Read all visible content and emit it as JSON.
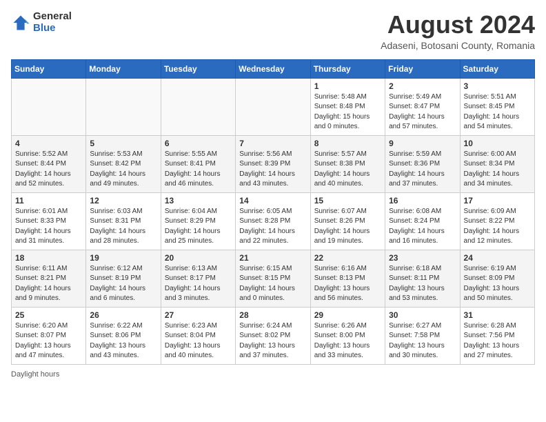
{
  "header": {
    "logo_general": "General",
    "logo_blue": "Blue",
    "title": "August 2024",
    "subtitle": "Adaseni, Botosani County, Romania"
  },
  "days_of_week": [
    "Sunday",
    "Monday",
    "Tuesday",
    "Wednesday",
    "Thursday",
    "Friday",
    "Saturday"
  ],
  "weeks": [
    [
      {
        "day": "",
        "info": ""
      },
      {
        "day": "",
        "info": ""
      },
      {
        "day": "",
        "info": ""
      },
      {
        "day": "",
        "info": ""
      },
      {
        "day": "1",
        "info": "Sunrise: 5:48 AM\nSunset: 8:48 PM\nDaylight: 15 hours\nand 0 minutes."
      },
      {
        "day": "2",
        "info": "Sunrise: 5:49 AM\nSunset: 8:47 PM\nDaylight: 14 hours\nand 57 minutes."
      },
      {
        "day": "3",
        "info": "Sunrise: 5:51 AM\nSunset: 8:45 PM\nDaylight: 14 hours\nand 54 minutes."
      }
    ],
    [
      {
        "day": "4",
        "info": "Sunrise: 5:52 AM\nSunset: 8:44 PM\nDaylight: 14 hours\nand 52 minutes."
      },
      {
        "day": "5",
        "info": "Sunrise: 5:53 AM\nSunset: 8:42 PM\nDaylight: 14 hours\nand 49 minutes."
      },
      {
        "day": "6",
        "info": "Sunrise: 5:55 AM\nSunset: 8:41 PM\nDaylight: 14 hours\nand 46 minutes."
      },
      {
        "day": "7",
        "info": "Sunrise: 5:56 AM\nSunset: 8:39 PM\nDaylight: 14 hours\nand 43 minutes."
      },
      {
        "day": "8",
        "info": "Sunrise: 5:57 AM\nSunset: 8:38 PM\nDaylight: 14 hours\nand 40 minutes."
      },
      {
        "day": "9",
        "info": "Sunrise: 5:59 AM\nSunset: 8:36 PM\nDaylight: 14 hours\nand 37 minutes."
      },
      {
        "day": "10",
        "info": "Sunrise: 6:00 AM\nSunset: 8:34 PM\nDaylight: 14 hours\nand 34 minutes."
      }
    ],
    [
      {
        "day": "11",
        "info": "Sunrise: 6:01 AM\nSunset: 8:33 PM\nDaylight: 14 hours\nand 31 minutes."
      },
      {
        "day": "12",
        "info": "Sunrise: 6:03 AM\nSunset: 8:31 PM\nDaylight: 14 hours\nand 28 minutes."
      },
      {
        "day": "13",
        "info": "Sunrise: 6:04 AM\nSunset: 8:29 PM\nDaylight: 14 hours\nand 25 minutes."
      },
      {
        "day": "14",
        "info": "Sunrise: 6:05 AM\nSunset: 8:28 PM\nDaylight: 14 hours\nand 22 minutes."
      },
      {
        "day": "15",
        "info": "Sunrise: 6:07 AM\nSunset: 8:26 PM\nDaylight: 14 hours\nand 19 minutes."
      },
      {
        "day": "16",
        "info": "Sunrise: 6:08 AM\nSunset: 8:24 PM\nDaylight: 14 hours\nand 16 minutes."
      },
      {
        "day": "17",
        "info": "Sunrise: 6:09 AM\nSunset: 8:22 PM\nDaylight: 14 hours\nand 12 minutes."
      }
    ],
    [
      {
        "day": "18",
        "info": "Sunrise: 6:11 AM\nSunset: 8:21 PM\nDaylight: 14 hours\nand 9 minutes."
      },
      {
        "day": "19",
        "info": "Sunrise: 6:12 AM\nSunset: 8:19 PM\nDaylight: 14 hours\nand 6 minutes."
      },
      {
        "day": "20",
        "info": "Sunrise: 6:13 AM\nSunset: 8:17 PM\nDaylight: 14 hours\nand 3 minutes."
      },
      {
        "day": "21",
        "info": "Sunrise: 6:15 AM\nSunset: 8:15 PM\nDaylight: 14 hours\nand 0 minutes."
      },
      {
        "day": "22",
        "info": "Sunrise: 6:16 AM\nSunset: 8:13 PM\nDaylight: 13 hours\nand 56 minutes."
      },
      {
        "day": "23",
        "info": "Sunrise: 6:18 AM\nSunset: 8:11 PM\nDaylight: 13 hours\nand 53 minutes."
      },
      {
        "day": "24",
        "info": "Sunrise: 6:19 AM\nSunset: 8:09 PM\nDaylight: 13 hours\nand 50 minutes."
      }
    ],
    [
      {
        "day": "25",
        "info": "Sunrise: 6:20 AM\nSunset: 8:07 PM\nDaylight: 13 hours\nand 47 minutes."
      },
      {
        "day": "26",
        "info": "Sunrise: 6:22 AM\nSunset: 8:06 PM\nDaylight: 13 hours\nand 43 minutes."
      },
      {
        "day": "27",
        "info": "Sunrise: 6:23 AM\nSunset: 8:04 PM\nDaylight: 13 hours\nand 40 minutes."
      },
      {
        "day": "28",
        "info": "Sunrise: 6:24 AM\nSunset: 8:02 PM\nDaylight: 13 hours\nand 37 minutes."
      },
      {
        "day": "29",
        "info": "Sunrise: 6:26 AM\nSunset: 8:00 PM\nDaylight: 13 hours\nand 33 minutes."
      },
      {
        "day": "30",
        "info": "Sunrise: 6:27 AM\nSunset: 7:58 PM\nDaylight: 13 hours\nand 30 minutes."
      },
      {
        "day": "31",
        "info": "Sunrise: 6:28 AM\nSunset: 7:56 PM\nDaylight: 13 hours\nand 27 minutes."
      }
    ]
  ],
  "footer": {
    "note": "Daylight hours"
  }
}
